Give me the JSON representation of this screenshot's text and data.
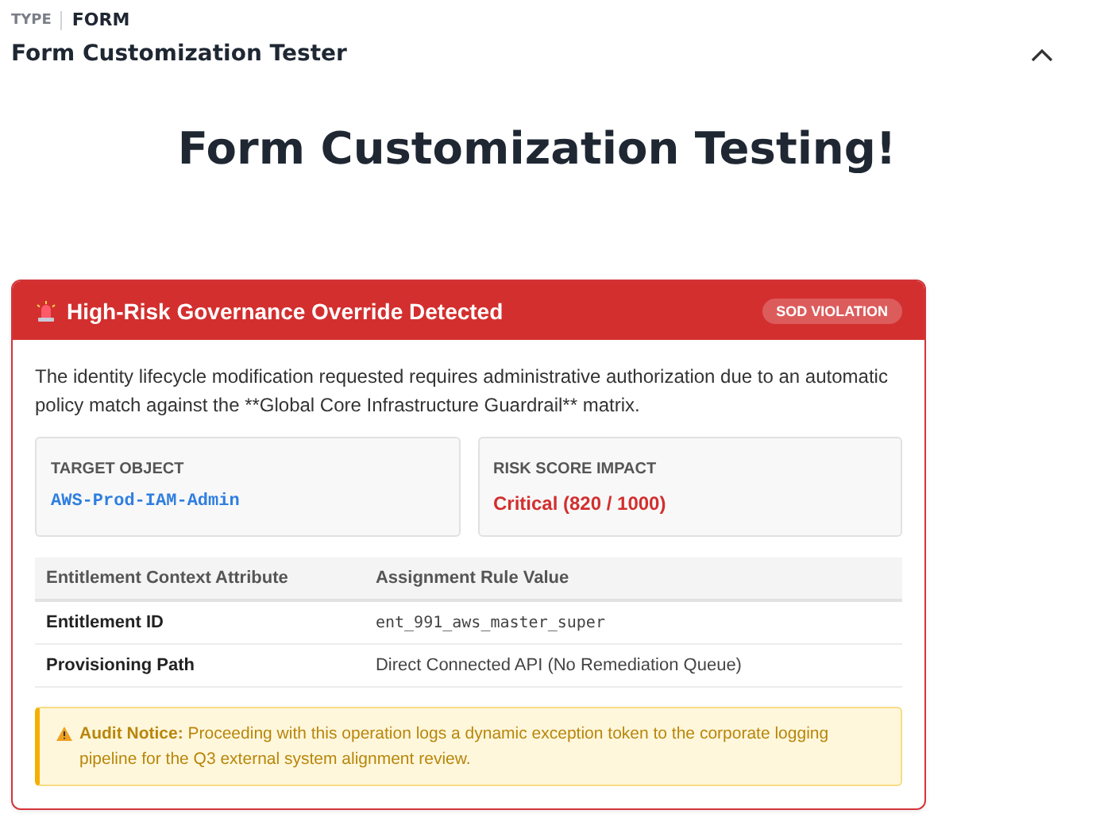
{
  "meta": {
    "type_label": "TYPE",
    "type_value": "FORM"
  },
  "title": "Form Customization Tester",
  "section": {
    "expanded": true
  },
  "heading": "Form Customization Testing!",
  "alert": {
    "title": "High-Risk Governance Override Detected",
    "badge": "SOD VIOLATION",
    "description": "The identity lifecycle modification requested requires administrative authorization due to an automatic policy match against the **Global Core Infrastructure Guardrail** matrix.",
    "stats": [
      {
        "label": "TARGET OBJECT",
        "value": "AWS-Prod-IAM-Admin",
        "kind": "code"
      },
      {
        "label": "RISK SCORE IMPACT",
        "value": "Critical (820 / 1000)",
        "kind": "danger"
      }
    ],
    "table": {
      "columns": [
        "Entitlement Context Attribute",
        "Assignment Rule Value"
      ],
      "rows": [
        {
          "attribute": "Entitlement ID",
          "value": "ent_991_aws_master_super",
          "kind": "code"
        },
        {
          "attribute": "Provisioning Path",
          "value": "Direct Connected API (No Remediation Queue)",
          "kind": "text"
        }
      ]
    },
    "notice": {
      "label": "Audit Notice:",
      "text": "Proceeding with this operation logs a dynamic exception token to the corporate logging pipeline for the Q3 external system alignment review."
    }
  }
}
